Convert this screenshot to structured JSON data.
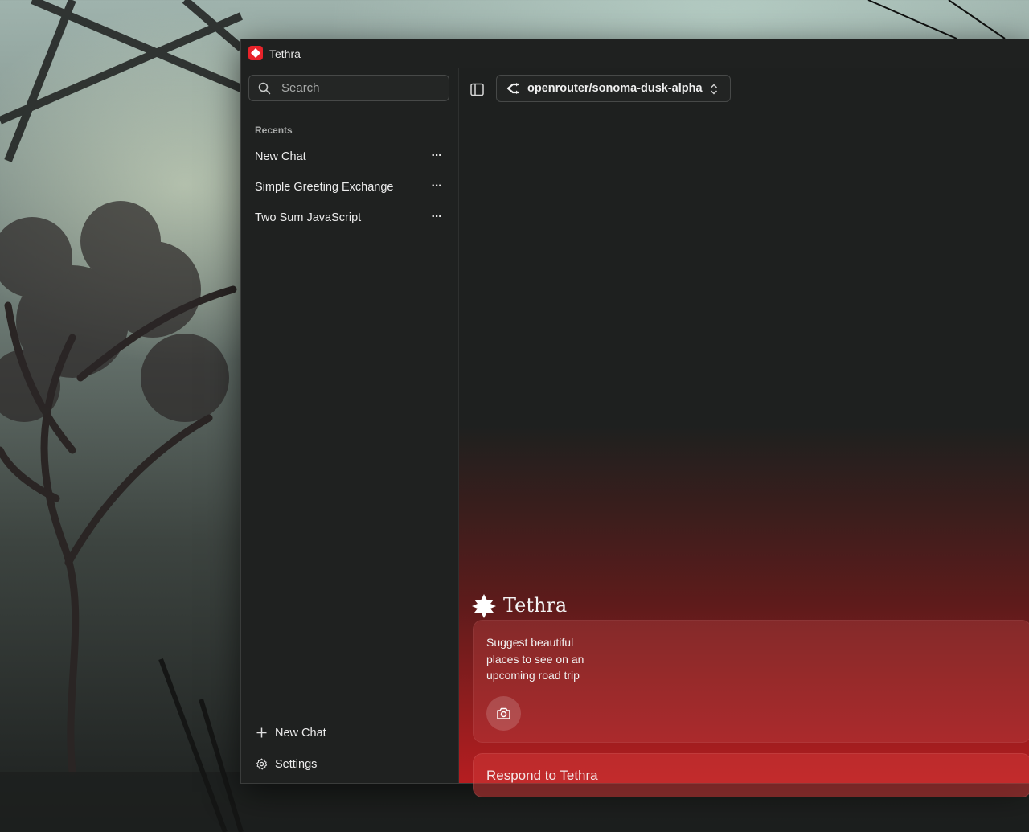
{
  "app": {
    "title": "Tethra",
    "accent": "#e8232a"
  },
  "sidebar": {
    "search_placeholder": "Search",
    "recents_label": "Recents",
    "chats": [
      {
        "label": "New Chat"
      },
      {
        "label": "Simple Greeting Exchange"
      },
      {
        "label": "Two Sum JavaScript"
      }
    ],
    "new_chat_label": "New Chat",
    "settings_label": "Settings"
  },
  "header": {
    "model_label": "openrouter/sonoma-dusk-alpha"
  },
  "main": {
    "brand_name": "Tethra",
    "suggestion_text": "Suggest beautiful places to see on an upcoming road trip",
    "respond_placeholder": "Respond to Tethra"
  },
  "icons": {
    "search": "search-icon",
    "more": "more-icon",
    "plus": "plus-icon",
    "settings": "gear-icon",
    "sidebar_toggle": "sidebar-toggle-icon",
    "provider": "openrouter-icon",
    "chevrons": "chevron-updown-icon",
    "camera": "camera-icon"
  }
}
